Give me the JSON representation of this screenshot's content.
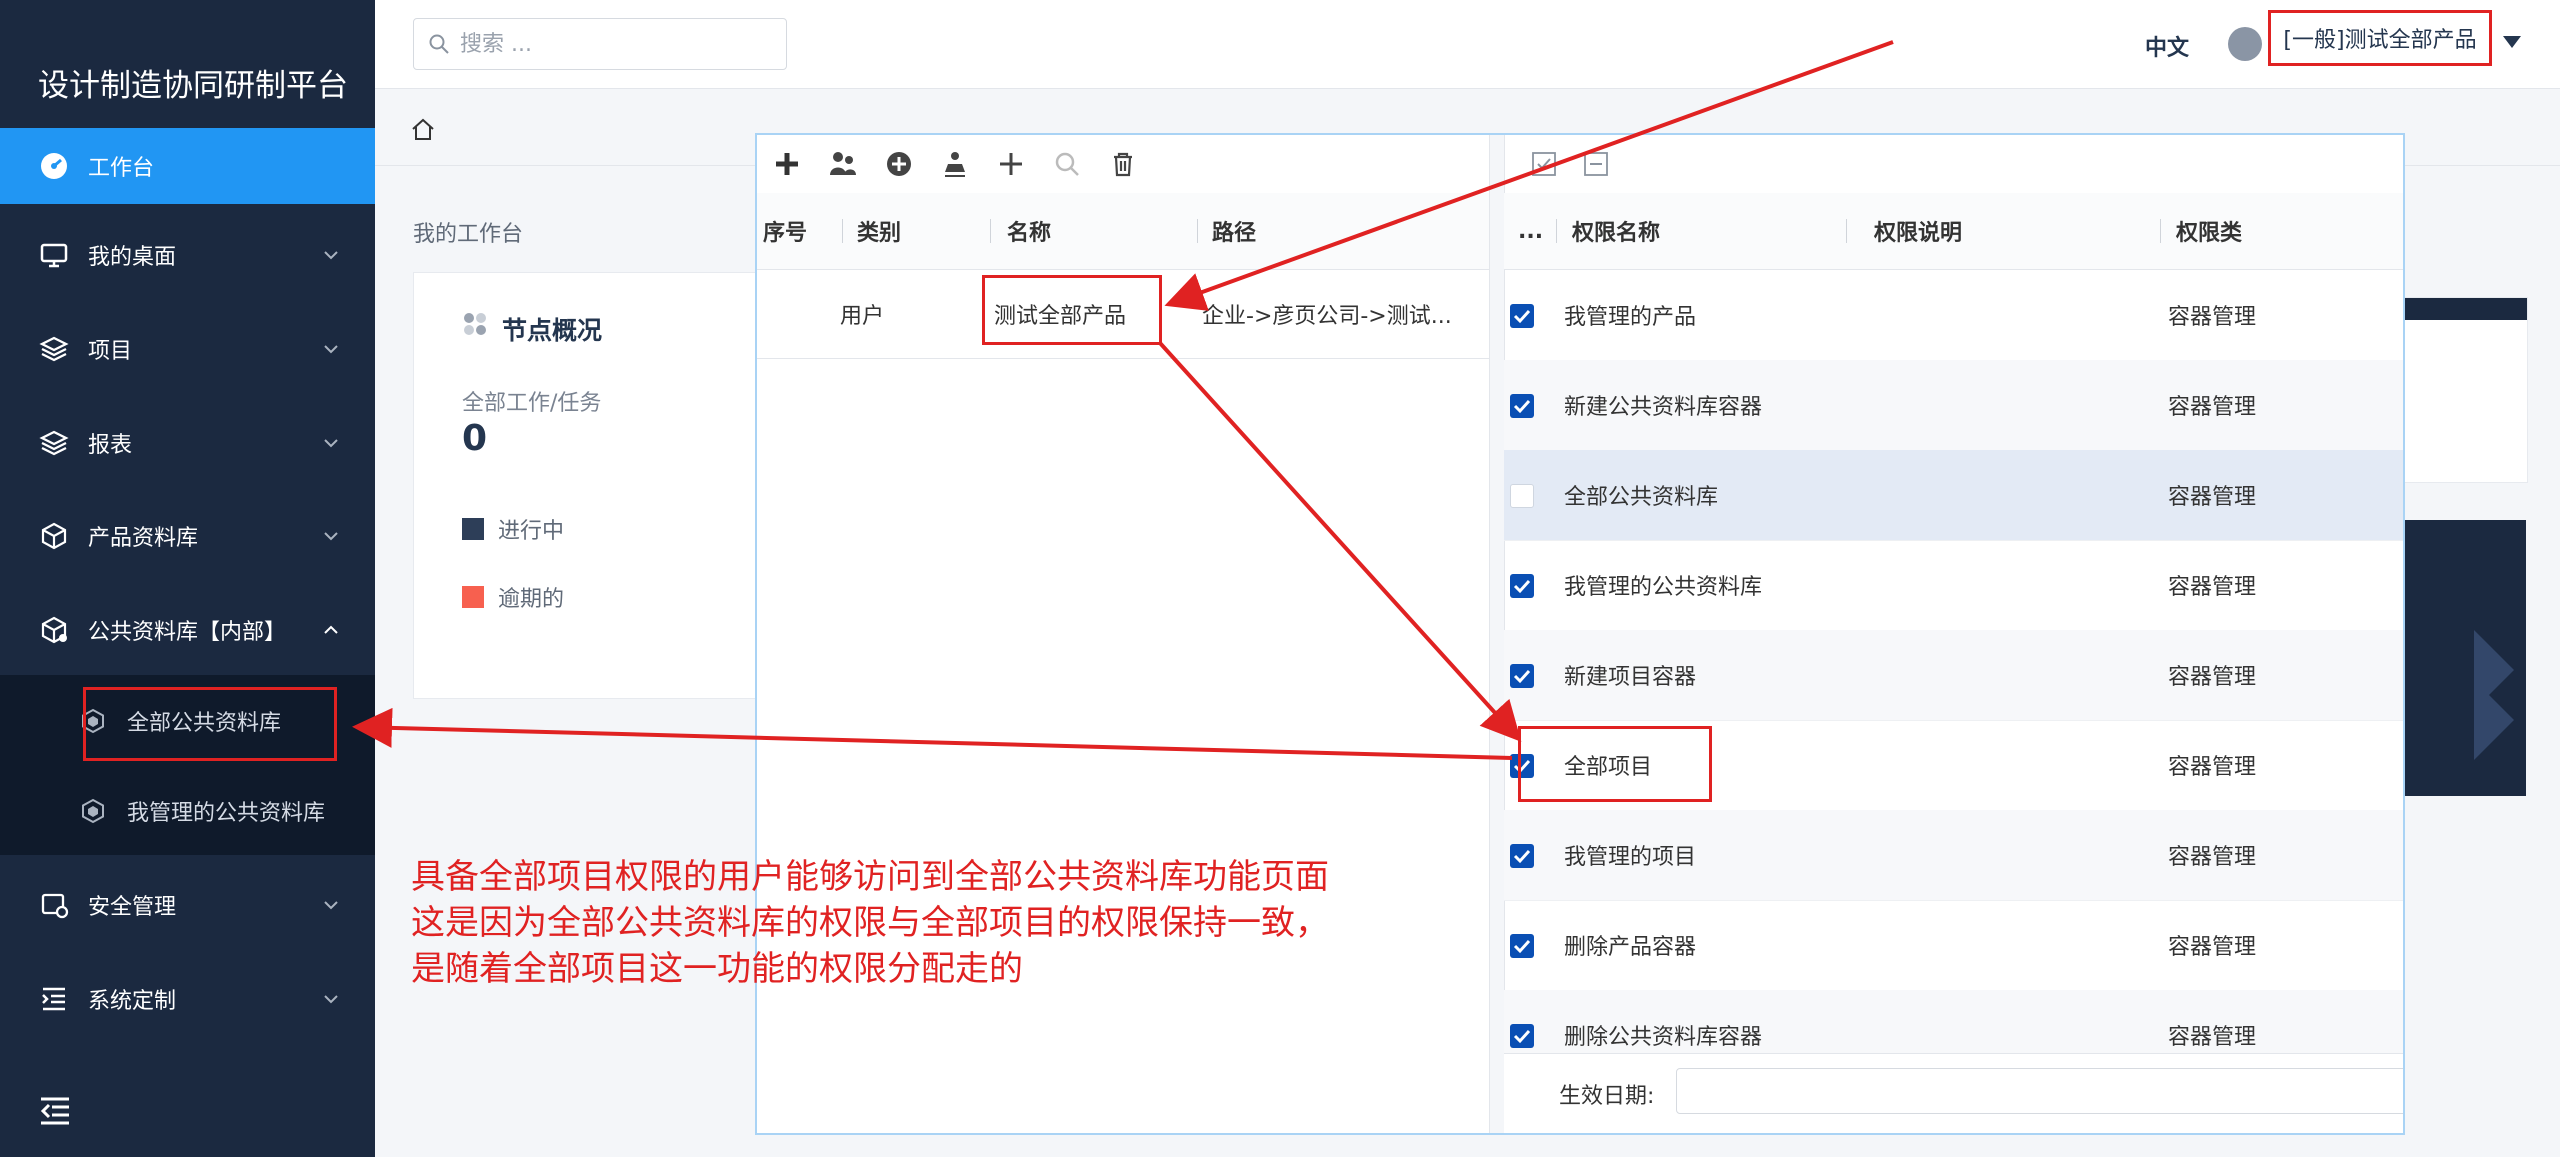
{
  "brand": "设计制造协同研制平台",
  "sidebar": {
    "items": [
      {
        "label": "工作台",
        "icon": "dashboard-icon"
      },
      {
        "label": "我的桌面",
        "icon": "monitor-icon"
      },
      {
        "label": "项目",
        "icon": "layers-icon"
      },
      {
        "label": "报表",
        "icon": "report-icon"
      },
      {
        "label": "产品资料库",
        "icon": "cube-icon"
      },
      {
        "label": "公共资料库【内部】",
        "icon": "shared-cube-icon"
      },
      {
        "label": "安全管理",
        "icon": "security-icon"
      },
      {
        "label": "系统定制",
        "icon": "list-indent-icon"
      }
    ],
    "subitems": [
      {
        "label": "全部公共资料库",
        "icon": "hex-icon"
      },
      {
        "label": "我管理的公共资料库",
        "icon": "hex-icon"
      }
    ]
  },
  "search": {
    "placeholder": "搜索 ..."
  },
  "header": {
    "language": "中文",
    "user": "[一般]测试全部产品"
  },
  "workspace": {
    "title": "我的工作台",
    "card_title": "节点概况",
    "metric_label": "全部工作/任务",
    "metric_value": "0",
    "legend": [
      {
        "label": "进行中",
        "color": "#2d3e58"
      },
      {
        "label": "逾期的",
        "color": "#f7604f"
      }
    ]
  },
  "dialog": {
    "left_table": {
      "columns": [
        "序号",
        "类别",
        "名称",
        "路径"
      ],
      "rows": [
        {
          "type": "用户",
          "name": "测试全部产品",
          "path": "企业->彦页公司->测试..."
        }
      ]
    },
    "right_table": {
      "columns": [
        "...",
        "权限名称",
        "权限说明",
        "权限类"
      ],
      "rows": [
        {
          "name": "我管理的产品",
          "type": "容器管理",
          "checked": true
        },
        {
          "name": "新建公共资料库容器",
          "type": "容器管理",
          "checked": true
        },
        {
          "name": "全部公共资料库",
          "type": "容器管理",
          "checked": false
        },
        {
          "name": "我管理的公共资料库",
          "type": "容器管理",
          "checked": true
        },
        {
          "name": "新建项目容器",
          "type": "容器管理",
          "checked": true
        },
        {
          "name": "全部项目",
          "type": "容器管理",
          "checked": true
        },
        {
          "name": "我管理的项目",
          "type": "容器管理",
          "checked": true
        },
        {
          "name": "删除产品容器",
          "type": "容器管理",
          "checked": true
        },
        {
          "name": "删除公共资料库容器",
          "type": "容器管理",
          "checked": true
        }
      ]
    },
    "date_label": "生效日期:"
  },
  "annotation": {
    "line1": "具备全部项目权限的用户能够访问到全部公共资料库功能页面",
    "line2": "这是因为全部公共资料库的权限与全部项目的权限保持一致，",
    "line3": "是随着全部项目这一功能的权限分配走的"
  },
  "colors": {
    "sidebar": "#1b2940",
    "active": "#2196f3",
    "annotation": "#e02222",
    "checkbox": "#0a4fb4"
  }
}
